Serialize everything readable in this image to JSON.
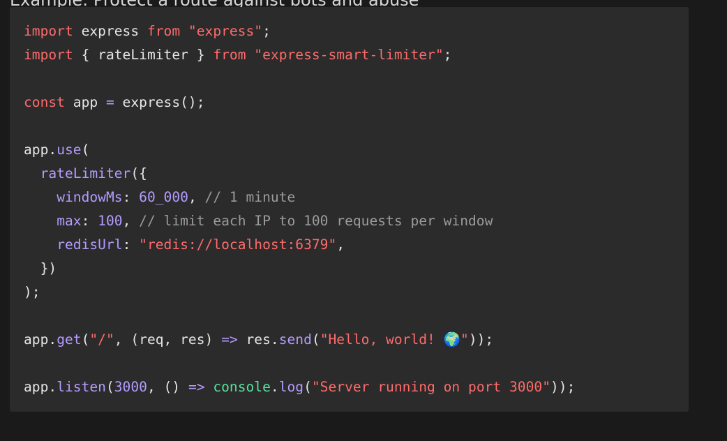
{
  "page_heading": "Example: Protect a route against bots and abuse",
  "code": {
    "line1": {
      "kw_import": "import",
      "ident": " express ",
      "kw_from": "from",
      "str": " \"express\"",
      "semi": ";"
    },
    "line2": {
      "kw_import": "import",
      "ident": " { rateLimiter } ",
      "kw_from": "from",
      "str": " \"express-smart-limiter\"",
      "semi": ";"
    },
    "line4": {
      "kw_const": "const",
      "ident": " app ",
      "op": "=",
      "rest": " express();"
    },
    "line6": {
      "app": "app.",
      "use": "use",
      "paren": "("
    },
    "line7": {
      "indent": "  ",
      "fn": "rateLimiter",
      "rest": "({"
    },
    "line8": {
      "indent": "    ",
      "key": "windowMs",
      "colon": ": ",
      "num": "60_000",
      "comma": ", ",
      "comment": "// 1 minute"
    },
    "line9": {
      "indent": "    ",
      "key": "max",
      "colon": ": ",
      "num": "100",
      "comma": ", ",
      "comment": "// limit each IP to 100 requests per window"
    },
    "line10": {
      "indent": "    ",
      "key": "redisUrl",
      "colon": ": ",
      "str": "\"redis://localhost:6379\"",
      "comma": ","
    },
    "line11": {
      "text": "  })"
    },
    "line12": {
      "text": ");"
    },
    "line14": {
      "app": "app.",
      "get": "get",
      "p1": "(",
      "route": "\"/\"",
      "p2": ", (req, res) ",
      "arrow": "=>",
      "p3": " res.",
      "send": "send",
      "p4": "(",
      "str": "\"Hello, world! 🌍\"",
      "p5": "));"
    },
    "line16": {
      "app": "app.",
      "listen": "listen",
      "p1": "(",
      "num": "3000",
      "p2": ", () ",
      "arrow": "=>",
      "sp": " ",
      "console": "console",
      "dot": ".",
      "log": "log",
      "p3": "(",
      "str": "\"Server running on port 3000\"",
      "p4": "));"
    }
  }
}
